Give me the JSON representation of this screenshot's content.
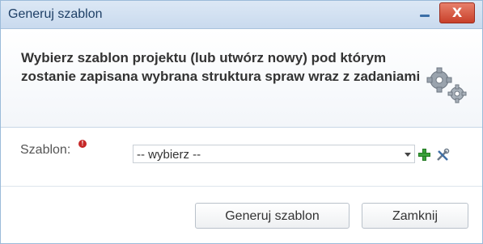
{
  "window": {
    "title": "Generuj szablon",
    "close_glyph": "X"
  },
  "header": {
    "text": "Wybierz szablon projektu (lub utwórz nowy) pod którym zostanie zapisana wybrana struktura spraw wraz z zadaniami",
    "icon": "gears-icon"
  },
  "form": {
    "template_label": "Szablon:",
    "required_marker": "!",
    "template_select_value": "-- wybierz --"
  },
  "buttons": {
    "generate_label": "Generuj szablon",
    "close_label": "Zamknij"
  },
  "colors": {
    "titlebar": "#c9daee",
    "close_button": "#c8402a",
    "add_icon": "#3aa13a",
    "required_marker": "#c62828"
  }
}
